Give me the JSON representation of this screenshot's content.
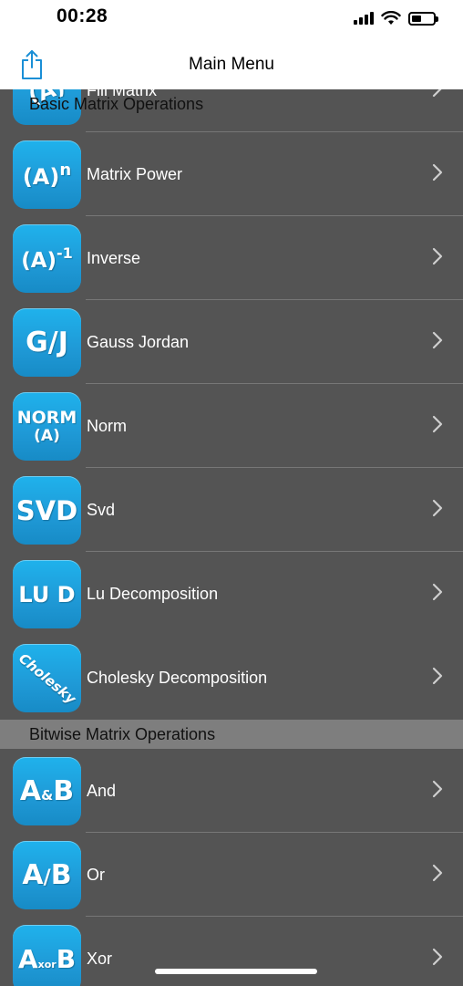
{
  "status_bar": {
    "time": "00:28"
  },
  "nav": {
    "title": "Main Menu",
    "share_icon": "share-icon"
  },
  "sections": {
    "basic": "Basic Matrix Operations",
    "bitwise": "Bitwise Matrix Operations"
  },
  "items": [
    {
      "label": "Fill Matrix",
      "icon": "fill-matrix-icon",
      "icon_text": "(A)"
    },
    {
      "label": "Matrix Power",
      "icon": "matrix-power-icon",
      "icon_text": "(A)",
      "icon_sup": "n"
    },
    {
      "label": "Inverse",
      "icon": "inverse-icon",
      "icon_text": "(A)",
      "icon_sup": "-1"
    },
    {
      "label": "Gauss Jordan",
      "icon": "gauss-jordan-icon",
      "icon_text": "G/J"
    },
    {
      "label": "Norm",
      "icon": "norm-icon",
      "icon_text": "NORM",
      "icon_sub_line": "(A)"
    },
    {
      "label": "Svd",
      "icon": "svd-icon",
      "icon_text": "SVD"
    },
    {
      "label": "Lu Decomposition",
      "icon": "lu-decomposition-icon",
      "icon_text": "LU D"
    },
    {
      "label": "Cholesky Decomposition",
      "icon": "cholesky-icon",
      "icon_text": "Cholesky"
    },
    {
      "label": "And",
      "icon": "and-icon",
      "icon_text": "A",
      "icon_mid": "&",
      "icon_end": "B"
    },
    {
      "label": "Or",
      "icon": "or-icon",
      "icon_text": "A",
      "icon_mid": "/",
      "icon_end": "B"
    },
    {
      "label": "Xor",
      "icon": "xor-icon",
      "icon_text": "A",
      "icon_mid": "xor",
      "icon_end": "B"
    }
  ],
  "colors": {
    "list_bg": "#545454",
    "section_bg": "#7e7e7e",
    "icon_tile": "#1fa5e0",
    "accent": "#1a8fd6"
  }
}
